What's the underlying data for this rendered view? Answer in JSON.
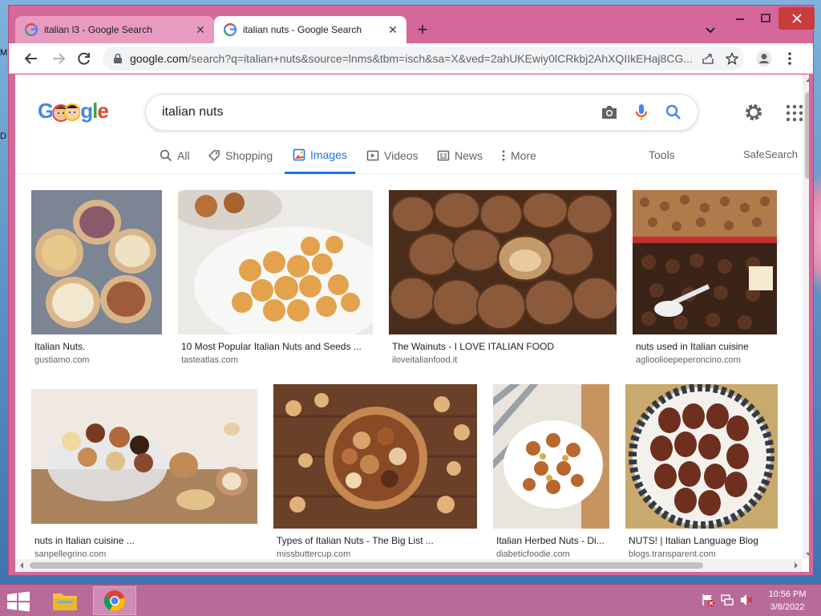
{
  "desktop": {
    "edge_text_1": "M",
    "edge_text_2": "D"
  },
  "browser": {
    "tabs": [
      {
        "title": "italian l3 - Google Search",
        "active": false
      },
      {
        "title": "italian nuts - Google Search",
        "active": true
      }
    ],
    "url_host": "google.com",
    "url_path": "/search?q=italian+nuts&source=lnms&tbm=isch&sa=X&ved=2ahUKEwiy0lCRkbj2AhXQIIkEHaj8CG..."
  },
  "page": {
    "logo": "Google",
    "query": "italian nuts",
    "nav": [
      {
        "label": "All",
        "icon": "search-icon",
        "active": false
      },
      {
        "label": "Shopping",
        "icon": "tag-icon",
        "active": false
      },
      {
        "label": "Images",
        "icon": "image-icon",
        "active": true
      },
      {
        "label": "Videos",
        "icon": "video-icon",
        "active": false
      },
      {
        "label": "News",
        "icon": "news-icon",
        "active": false
      },
      {
        "label": "More",
        "icon": "more-vert-icon",
        "active": false
      }
    ],
    "tools": "Tools",
    "safesearch": "SafeSearch",
    "results": [
      {
        "title": "Italian Nuts.",
        "source": "gustiamo.com"
      },
      {
        "title": "10 Most Popular Italian Nuts and Seeds ...",
        "source": "tasteatlas.com"
      },
      {
        "title": "The Wainuts - I LOVE ITALIAN FOOD",
        "source": "iloveitalianfood.it"
      },
      {
        "title": "nuts used in Italian cuisine",
        "source": "aglioolioepeperoncino.com"
      },
      {
        "title": "nuts in Italian cuisine ...",
        "source": "sanpellegrino.com"
      },
      {
        "title": "Types of Italian Nuts - The Big List ...",
        "source": "missbuttercup.com"
      },
      {
        "title": "Italian Herbed Nuts - Di...",
        "source": "diabeticfoodie.com"
      },
      {
        "title": "NUTS! | Italian Language Blog",
        "source": "blogs.transparent.com"
      }
    ]
  },
  "taskbar": {
    "time": "10:56 PM",
    "date": "3/8/2022"
  },
  "colors": {
    "accent": "#1a73e8",
    "frame": "#d6679b",
    "taskbar": "#b86a98"
  }
}
